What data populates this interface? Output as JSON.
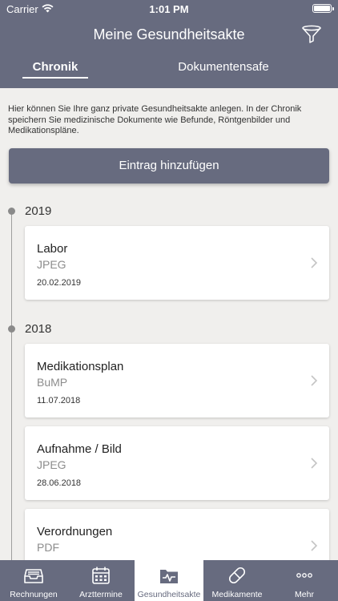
{
  "status": {
    "carrier": "Carrier",
    "time": "1:01 PM"
  },
  "header": {
    "title": "Meine Gesundheitsakte",
    "filter_icon": "filter-icon",
    "tabs": [
      {
        "label": "Chronik",
        "active": true
      },
      {
        "label": "Dokumentensafe",
        "active": false
      }
    ]
  },
  "intro": "Hier können Sie Ihre ganz private Gesundheitsakte anlegen. In der Chronik speichern Sie medizinische Dokumente wie Befunde, Röntgenbilder und Medikationspläne.",
  "add_button_label": "Eintrag hinzufügen",
  "timeline": {
    "years": [
      "2019",
      "2018"
    ],
    "entries": [
      {
        "title": "Labor",
        "type": "JPEG",
        "date": "20.02.2019"
      },
      {
        "title": "Medikationsplan",
        "type": "BuMP",
        "date": "11.07.2018"
      },
      {
        "title": "Aufnahme / Bild",
        "type": "JPEG",
        "date": "28.06.2018"
      },
      {
        "title": "Verordnungen",
        "type": "PDF",
        "date": ""
      }
    ]
  },
  "tabbar": {
    "items": [
      {
        "label": "Rechnungen",
        "icon": "inbox-icon",
        "active": false
      },
      {
        "label": "Arzttermine",
        "icon": "calendar-icon",
        "active": false
      },
      {
        "label": "Gesundheitsakte",
        "icon": "health-folder-icon",
        "active": true
      },
      {
        "label": "Medikamente",
        "icon": "pill-icon",
        "active": false
      },
      {
        "label": "Mehr",
        "icon": "more-icon",
        "active": false
      }
    ]
  },
  "colors": {
    "header": "#676b7f",
    "background": "#f0efed",
    "card": "#ffffff"
  }
}
